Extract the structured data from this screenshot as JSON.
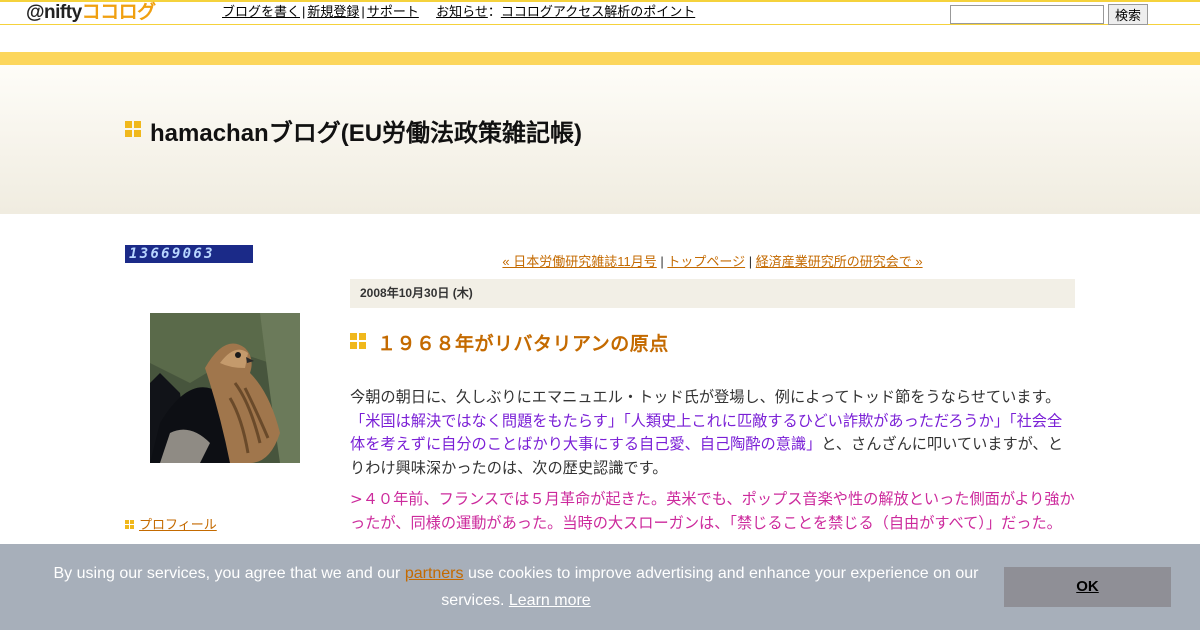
{
  "topbar": {
    "logo_at_nifty": "@nifty",
    "logo_cocolog": "ココログ",
    "nav": {
      "write_blog": "ブログを書く",
      "register": "新規登録",
      "support": "サポート",
      "news_label": "お知らせ",
      "news_colon": "：",
      "news_link": "ココログアクセス解析のポイント"
    },
    "search": {
      "value": "",
      "button": "検索"
    }
  },
  "header": {
    "blog_title": "hamachanブログ(EU労働法政策雑記帳)"
  },
  "sidebar": {
    "counter": "13669063",
    "profile_link": "プロフィール"
  },
  "main": {
    "pager": {
      "prev": "« 日本労働研究雑誌11月号",
      "sep1": " | ",
      "top": "トップページ",
      "sep2": " | ",
      "next": "経済産業研究所の研究会で »"
    },
    "date": "2008年10月30日 (木)",
    "entry_title": "１９６８年がリバタリアンの原点",
    "body": {
      "p1_a": "今朝の朝日に、久しぶりにエマニュエル・トッド氏が登場し、例によってトッド節をうならせています。",
      "p1_q1": "「米国は解決ではなく問題をもたらす」",
      "p1_q2": "「人類史上これに匹敵するひどい詐欺があっただろうか」",
      "p1_q3": "「社会全体を考えずに自分のことばかり大事にする自己愛、自己陶酔の意識」",
      "p1_b": "と、さんざんに叩いていますが、とりわけ興味深かったのは、次の歴史認識です。",
      "p2": ">４０年前、フランスでは５月革命が起きた。英米でも、ポップス音楽や性の解放といった側面がより強かったが、同様の運動があった。当時の大スローガンは、「禁じることを禁じる（自由がすべて）」だった。"
    }
  },
  "cookie": {
    "text_a": "By using our services, you agree that we and our ",
    "partners": "partners",
    "text_b": " use cookies to improve advertising and enhance your experience on our services. ",
    "learn_more": "Learn more",
    "ok": "OK"
  },
  "colors": {
    "accent_yellow": "#fcd65c",
    "link_orange": "#c46a00",
    "quote_purple": "#7a1fd6",
    "quote_pink": "#cc2a9c"
  }
}
